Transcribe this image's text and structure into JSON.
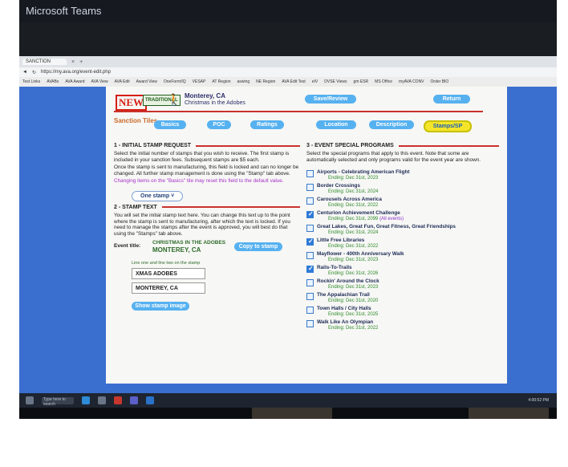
{
  "teams": {
    "title": "Microsoft Teams"
  },
  "browser": {
    "tab_label": "SANCTION",
    "tab_close": "×",
    "tab_new": "+",
    "url": "https://my.ava.org/event-edit.php",
    "bookmarks": [
      "Test Links",
      "AVABs",
      "AVA Award",
      "AVA View",
      "AVA Edit",
      "Award View",
      "OneForm/IQ",
      "VESAP",
      "AT Region",
      "aswing",
      "NE Region",
      "AVA Edit Test",
      "eIV",
      "DVSE Views",
      "gm ESR",
      "MS Office",
      "myAVA CONV",
      "Order BIO"
    ]
  },
  "header": {
    "logo_new": "NEW",
    "logo_traditional": "TRADITIONAL",
    "event_location": "Monterey, CA",
    "event_name": "Christmas in the Adobes",
    "save_label": "Save/Review",
    "return_label": "Return"
  },
  "tabs": {
    "sanction_label": "Sanction Tiles",
    "items": [
      "Basics",
      "POC",
      "Ratings",
      "Location",
      "Description",
      "Stamps/SP"
    ]
  },
  "stamp_request": {
    "title": "1 - INITIAL STAMP REQUEST",
    "p1": "Select the initial number of stamps that you wish to receive. The first stamp is included in your sanction fees. Subsequent stamps are $5 each.",
    "p2": "Once the stamp is sent to manufacturing, this field is locked and can no longer be changed. All further stamp management is done using the \"Stamp\" tab above.",
    "warning": "Changing items on the \"Basics\" tile may reset this field to the default value.",
    "dropdown_value": "One stamp ˅"
  },
  "stamp_text": {
    "title": "2 - STAMP TEXT",
    "p1": "You will set the initial stamp text here. You can change this text up to the point where the stamp is sent to manufacturing, after which the text is locked. If you need to manage the stamps after the event is approved, you will best do that using the \"Stamps\" tab above.",
    "event_title_label": "Event title:",
    "event_title_line1": "CHRISTMAS IN THE ADOBES",
    "event_title_line2": "MONTEREY, CA",
    "copy_label": "Copy to stamp",
    "hint": "Line one and line two on the stamp",
    "line1": "XMAS ADOBES",
    "line2": "MONTEREY, CA",
    "show_label": "Show stamp image"
  },
  "special_programs": {
    "title": "3 - EVENT SPECIAL PROGRAMS",
    "intro": "Select the special programs that apply to this event. Note that some are automatically selected and only programs valid for the event year are shown.",
    "ending_prefix": "Ending: ",
    "items": [
      {
        "name": "Airports - Celebrating American Flight",
        "ending": "Dec 31st, 2023",
        "checked": false,
        "all": ""
      },
      {
        "name": "Border Crossings",
        "ending": "Dec 31st, 2024",
        "checked": false,
        "all": ""
      },
      {
        "name": "Carousels Across America",
        "ending": "Dec 31st, 2022",
        "checked": false,
        "all": ""
      },
      {
        "name": "Centurion Achievement Challenge",
        "ending": "Dec 31st, 2099",
        "checked": true,
        "all": "(All events)"
      },
      {
        "name": "Great Lakes, Great Fun, Great Fitness, Great Friendships",
        "ending": "Dec 31st, 2024",
        "checked": false,
        "all": ""
      },
      {
        "name": "Little Free Libraries",
        "ending": "Dec 31st, 2022",
        "checked": true,
        "all": ""
      },
      {
        "name": "Mayflower - 400th Anniversary Walk",
        "ending": "Dec 31st, 2023",
        "checked": false,
        "all": ""
      },
      {
        "name": "Rails-To-Trails",
        "ending": "Dec 31st, 2026",
        "checked": true,
        "all": ""
      },
      {
        "name": "Rockin' Around the Clock",
        "ending": "Dec 31st, 2023",
        "checked": false,
        "all": ""
      },
      {
        "name": "The Appalachian Trail",
        "ending": "Dec 31st, 2020",
        "checked": false,
        "all": ""
      },
      {
        "name": "Town Halls / City Halls",
        "ending": "Dec 31st, 2025",
        "checked": false,
        "all": ""
      },
      {
        "name": "Walk Like An Olympian",
        "ending": "Dec 31st, 2022",
        "checked": false,
        "all": ""
      }
    ]
  },
  "taskbar": {
    "search_placeholder": "Type here to search",
    "time": "4:00:52 PM"
  }
}
